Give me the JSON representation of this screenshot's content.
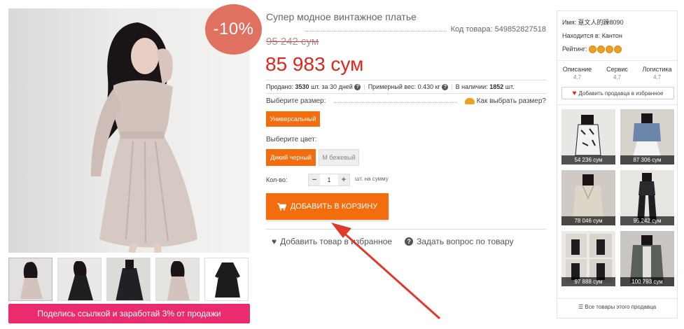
{
  "product": {
    "title": "Супер модное винтажное платье",
    "code": "Код товара: 549852827518",
    "discount": "-10%",
    "old_price": "95 242 сум",
    "price": "85 983 сум",
    "stats": {
      "sold_label": "Продано:",
      "sold_value": "3530",
      "sold_suffix": "шт. за 30 дней",
      "weight_label": "Примерный вес:",
      "weight_value": "0.430 кг",
      "stock_label": "В наличии:",
      "stock_value": "1852",
      "stock_suffix": "шт."
    },
    "size_label": "Выберите размер:",
    "size_guide": "Как выбрать размер?",
    "size_option": "Универсальный",
    "color_label": "Выберите цвет:",
    "colors": [
      "Дикий черный",
      "M бежевый"
    ],
    "qty_label": "Кол-во:",
    "qty_value": "1",
    "qty_minus": "−",
    "qty_plus": "+",
    "qty_note": "шт. на сумму",
    "cart_button": "ДОБАВИТЬ В КОРЗИНУ",
    "add_favorite": "Добавить товар в избранное",
    "ask_question": "Задать вопрос по товару",
    "share_bar": "Поделись ссылкой и заработай 3% от продажи"
  },
  "seller": {
    "name_label": "Имя:",
    "name_value": "趸文人的躁8090",
    "location_label": "Находится в:",
    "location_value": "Кантон",
    "rating_label": "Рейтинг:",
    "rating_stars": 4,
    "scores": [
      {
        "label": "Описание",
        "value": "4.7"
      },
      {
        "label": "Сервис",
        "value": "4.7"
      },
      {
        "label": "Логистика",
        "value": "4.7"
      }
    ],
    "favorite_button": "Добавить продавца в избранное",
    "items": [
      {
        "price": "54 236 сум"
      },
      {
        "price": "87 306 сум"
      },
      {
        "price": "78 046 сум"
      },
      {
        "price": "95 242 сум"
      },
      {
        "price": "97 888 сум"
      },
      {
        "price": "100 793 сум"
      }
    ],
    "all_goods": "Все товары этого продавца"
  },
  "colors": {
    "accent_orange": "#f36d0f",
    "price_red": "#e2241c",
    "discount_badge": "#e07060",
    "share_pink": "#ea2c6f"
  }
}
